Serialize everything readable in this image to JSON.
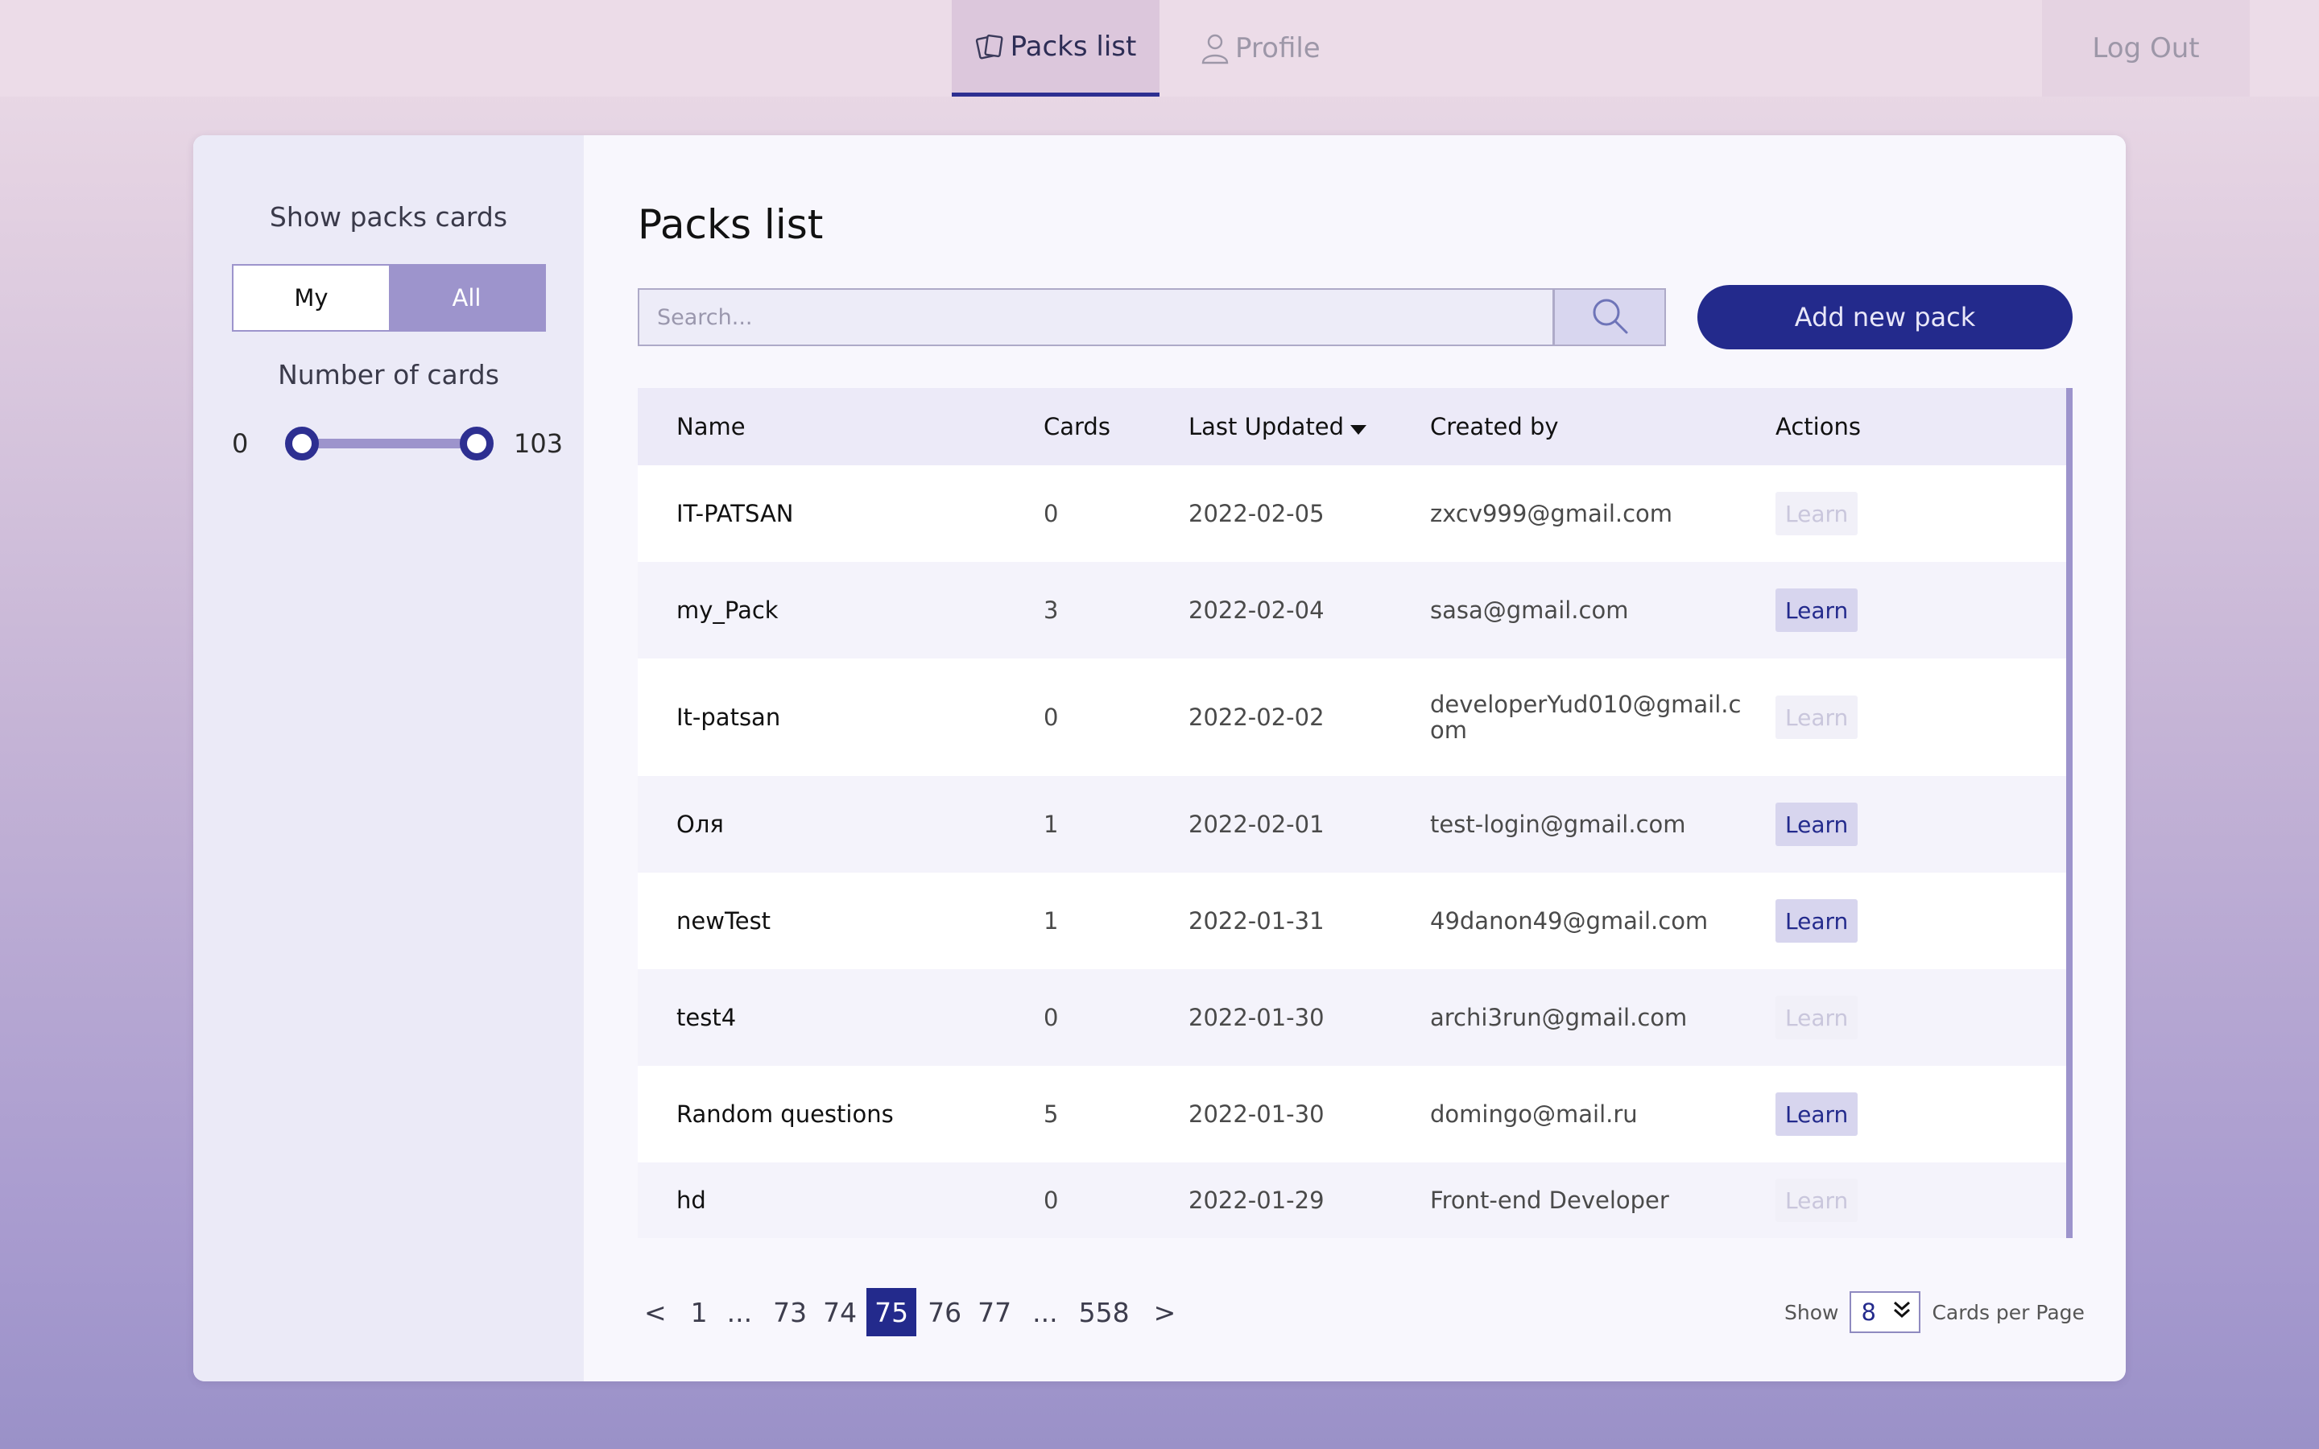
{
  "nav": {
    "tabs": [
      {
        "label": "Packs list",
        "active": true,
        "icon": "cards-icon"
      },
      {
        "label": "Profile",
        "active": false,
        "icon": "user-icon"
      }
    ],
    "logout_label": "Log Out"
  },
  "sidebar": {
    "show_title": "Show packs cards",
    "toggle": {
      "my": "My",
      "all": "All",
      "selected": "All"
    },
    "range_title": "Number of cards",
    "range_min": "0",
    "range_max": "103"
  },
  "main": {
    "title": "Packs list",
    "search_placeholder": "Search...",
    "add_button": "Add new pack"
  },
  "table": {
    "columns": [
      "Name",
      "Cards",
      "Last Updated",
      "Created by",
      "Actions"
    ],
    "sort_column": "Last Updated",
    "rows": [
      {
        "name": "IT-PATSAN",
        "cards": "0",
        "updated": "2022-02-05",
        "by": "zxcv999@gmail.com",
        "action": "Learn",
        "enabled": false
      },
      {
        "name": "my_Pack",
        "cards": "3",
        "updated": "2022-02-04",
        "by": "sasa@gmail.com",
        "action": "Learn",
        "enabled": true
      },
      {
        "name": "It-patsan",
        "cards": "0",
        "updated": "2022-02-02",
        "by": "developerYud010@gmail.com",
        "action": "Learn",
        "enabled": false
      },
      {
        "name": "Оля",
        "cards": "1",
        "updated": "2022-02-01",
        "by": "test-login@gmail.com",
        "action": "Learn",
        "enabled": true
      },
      {
        "name": "newTest",
        "cards": "1",
        "updated": "2022-01-31",
        "by": "49danon49@gmail.com",
        "action": "Learn",
        "enabled": true
      },
      {
        "name": "test4",
        "cards": "0",
        "updated": "2022-01-30",
        "by": "archi3run@gmail.com",
        "action": "Learn",
        "enabled": false
      },
      {
        "name": "Random questions",
        "cards": "5",
        "updated": "2022-01-30",
        "by": "domingo@mail.ru",
        "action": "Learn",
        "enabled": true
      },
      {
        "name": "hd",
        "cards": "0",
        "updated": "2022-01-29",
        "by": "Front-end Developer",
        "action": "Learn",
        "enabled": false
      }
    ]
  },
  "pagination": {
    "items": [
      "<",
      "1",
      "...",
      "73",
      "74",
      "75",
      "76",
      "77",
      "...",
      "558",
      ">"
    ],
    "current": "75",
    "show_label": "Show",
    "per_page": "8",
    "per_page_label": "Cards per Page"
  },
  "colors": {
    "accent": "#232a8c",
    "lilac": "#9d94cc"
  }
}
